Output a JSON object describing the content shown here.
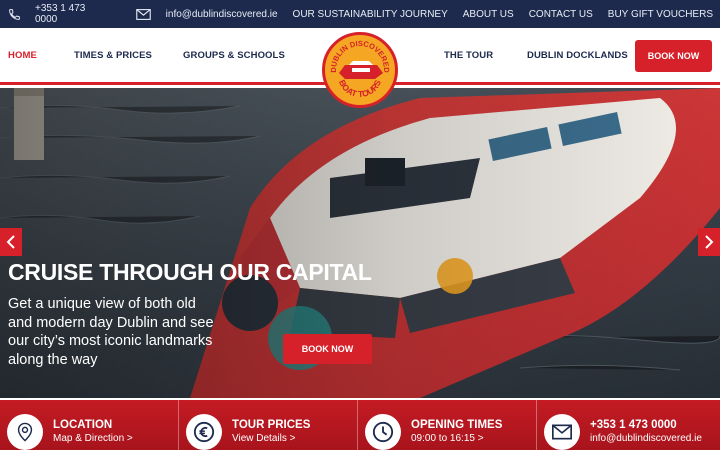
{
  "topbar": {
    "phone": "+353 1 473 0000",
    "email": "info@dublindiscovered.ie",
    "links": [
      "OUR SUSTAINABILITY JOURNEY",
      "ABOUT US",
      "CONTACT US",
      "BUY GIFT VOUCHERS"
    ]
  },
  "nav": {
    "home": "HOME",
    "times_prices": "TIMES & PRICES",
    "groups_schools": "GROUPS & SCHOOLS",
    "the_tour": "THE TOUR",
    "docklands": "DUBLIN DOCKLANDS",
    "book_now": "BOOK NOW"
  },
  "logo": {
    "top_text": "DUBLIN DISCOVERED",
    "bottom_text": "BOAT TOURS"
  },
  "hero": {
    "title": "CRUISE THROUGH OUR CAPITAL",
    "subtitle": "Get a unique view of both old and modern day Dublin and see our city’s most iconic landmarks along the way",
    "button": "BOOK NOW"
  },
  "info": [
    {
      "title": "LOCATION",
      "link": "Map & Direction >",
      "icon": "map-pin-icon"
    },
    {
      "title": "TOUR PRICES",
      "link": "View Details >",
      "icon": "euro-icon"
    },
    {
      "title": "OPENING TIMES",
      "link": "09:00 to 16:15 >",
      "icon": "clock-icon"
    },
    {
      "title": "+353 1 473 0000",
      "link": "info@dublindiscovered.ie",
      "icon": "mail-icon"
    }
  ],
  "colors": {
    "navy": "#1d2a4d",
    "red": "#d6212a",
    "orange": "#f5a623"
  }
}
